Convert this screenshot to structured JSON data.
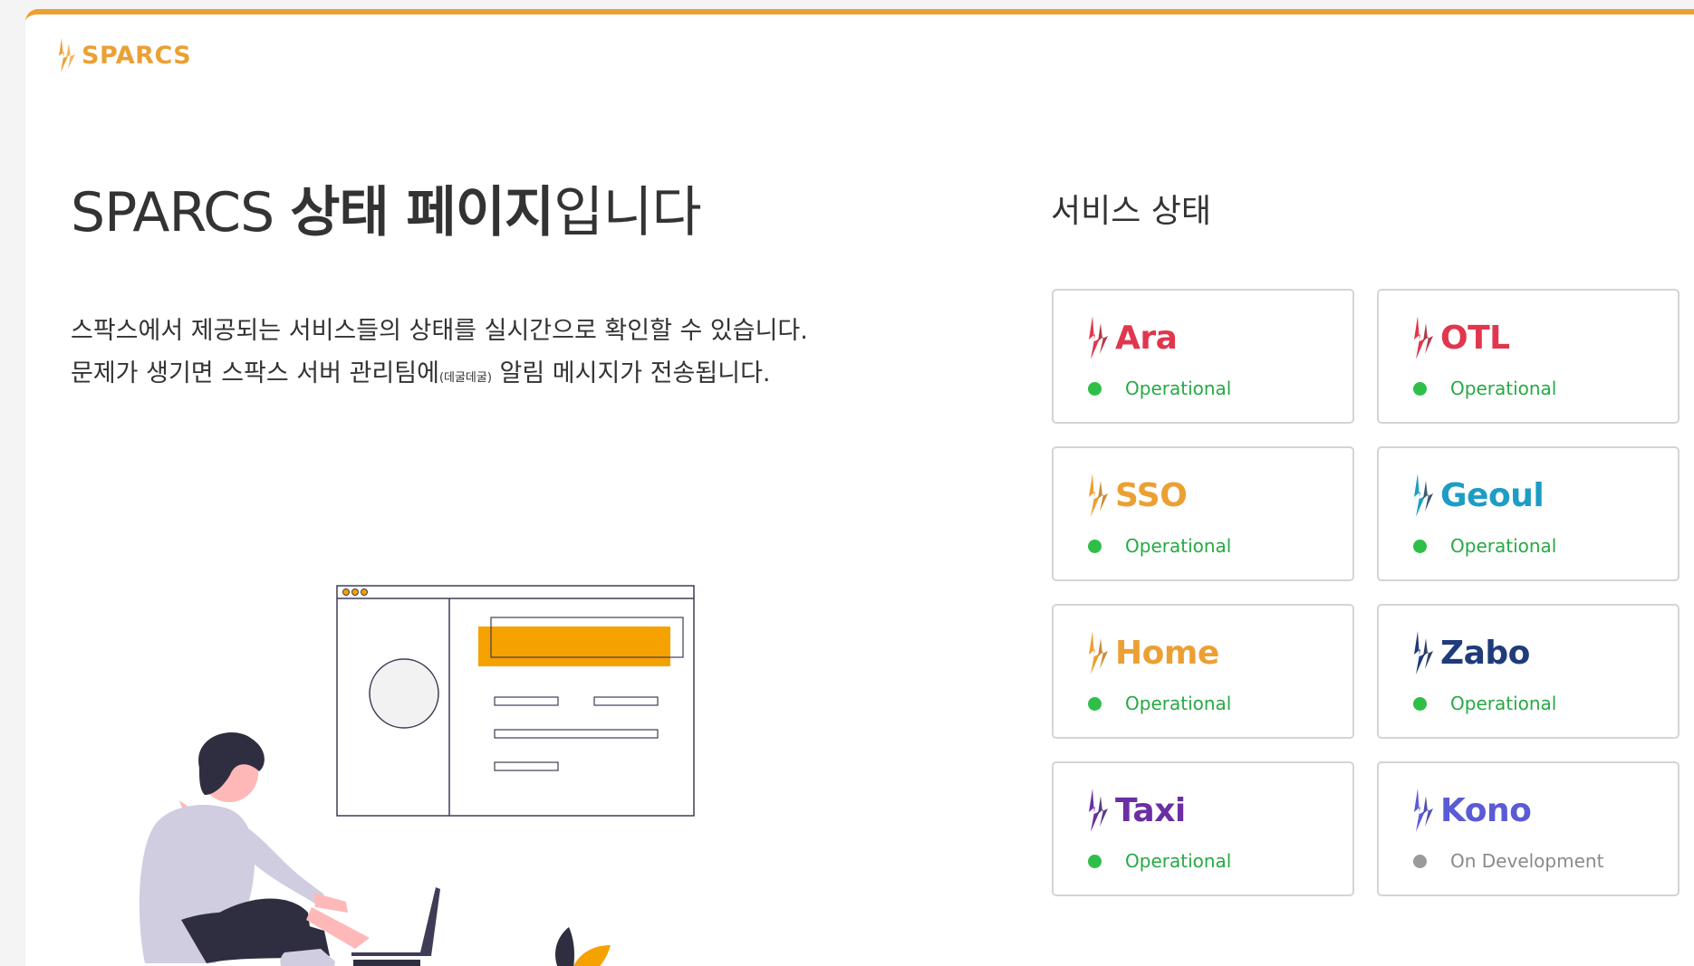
{
  "logo": {
    "text": "SPARCS",
    "color": "#eba034"
  },
  "headline": {
    "prefix": "SPARCS ",
    "bold": "상태 페이지",
    "suffix": "입니다"
  },
  "description": {
    "line1": "스팍스에서 제공되는 서비스들의 상태를 실시간으로 확인할 수 있습니다.",
    "line2_a": "문제가 생기면 스팍스 서버 관리팀에",
    "line2_small": "(데굴데굴)",
    "line2_b": " 알림 메시지가 전송됩니다."
  },
  "services_title": "서비스 상태",
  "services": [
    {
      "name": "Ara",
      "color": "#e0374e",
      "accent": "#a21a2d",
      "status": "Operational",
      "status_color": "#27a944",
      "dot_color": "#2fbf49"
    },
    {
      "name": "OTL",
      "color": "#e0374e",
      "accent": "#a21a2d",
      "status": "Operational",
      "status_color": "#27a944",
      "dot_color": "#2fbf49"
    },
    {
      "name": "SSO",
      "color": "#eba034",
      "accent": "#c07818",
      "status": "Operational",
      "status_color": "#27a944",
      "dot_color": "#2fbf49"
    },
    {
      "name": "Geoul",
      "color": "#1d9dc4",
      "accent": "#1d3f5a",
      "status": "Operational",
      "status_color": "#27a944",
      "dot_color": "#2fbf49"
    },
    {
      "name": "Home",
      "color": "#eba034",
      "accent": "#c07818",
      "status": "Operational",
      "status_color": "#27a944",
      "dot_color": "#2fbf49"
    },
    {
      "name": "Zabo",
      "color": "#1f3b7a",
      "accent": "#0f1f4a",
      "status": "Operational",
      "status_color": "#27a944",
      "dot_color": "#2fbf49"
    },
    {
      "name": "Taxi",
      "color": "#6b2fa3",
      "accent": "#3c1a66",
      "status": "Operational",
      "status_color": "#27a944",
      "dot_color": "#2fbf49"
    },
    {
      "name": "Kono",
      "color": "#5b5bd6",
      "accent": "#3232a0",
      "status": "On Development",
      "status_color": "#8a8a8a",
      "dot_color": "#9a9a9a"
    }
  ],
  "illustration_colors": {
    "accent": "#f5a100",
    "dark": "#2f2e41",
    "shirt": "#d0cde1",
    "skin": "#ffb8b8"
  }
}
